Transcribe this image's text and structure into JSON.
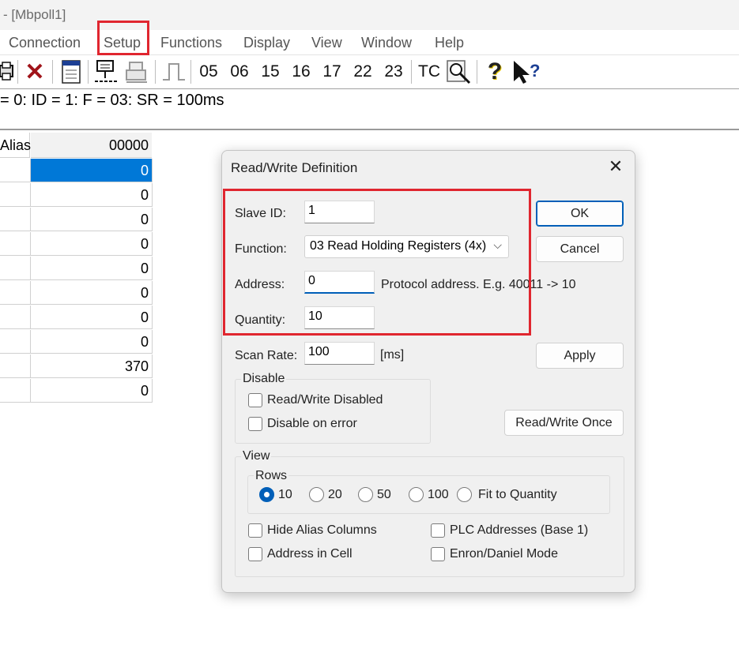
{
  "window": {
    "title": "- [Mbpoll1]"
  },
  "menu": [
    "Connection",
    "Setup",
    "Functions",
    "Display",
    "View",
    "Window",
    "Help"
  ],
  "toolbar": {
    "function_codes": [
      "05",
      "06",
      "15",
      "16",
      "17",
      "22",
      "23"
    ],
    "tc_label": "TC"
  },
  "status_line": "= 0: ID = 1: F = 03: SR = 100ms",
  "grid": {
    "alias_header": "Alias",
    "col_header": "00000",
    "values": [
      "0",
      "0",
      "0",
      "0",
      "0",
      "0",
      "0",
      "0",
      "370",
      "0"
    ]
  },
  "dialog": {
    "title": "Read/Write Definition",
    "slave_id_label": "Slave ID:",
    "slave_id_value": "1",
    "function_label": "Function:",
    "function_value": "03 Read Holding Registers (4x)",
    "address_label": "Address:",
    "address_value": "0",
    "address_hint": "Protocol address. E.g. 40011 -> 10",
    "quantity_label": "Quantity:",
    "quantity_value": "10",
    "scan_rate_label": "Scan Rate:",
    "scan_rate_value": "100",
    "scan_rate_unit": "[ms]",
    "ok_label": "OK",
    "cancel_label": "Cancel",
    "apply_label": "Apply",
    "rw_once_label": "Read/Write Once",
    "disable_group": "Disable",
    "rw_disabled": "Read/Write Disabled",
    "disable_on_error": "Disable on error",
    "view_group": "View",
    "rows_group": "Rows",
    "rows_options": [
      "10",
      "20",
      "50",
      "100",
      "Fit to Quantity"
    ],
    "rows_selected": "10",
    "hide_alias": "Hide Alias Columns",
    "plc_addresses": "PLC Addresses (Base 1)",
    "address_in_cell": "Address in Cell",
    "enron_mode": "Enron/Daniel Mode"
  },
  "colors": {
    "highlight": "#e0262f",
    "accent": "#005fb8",
    "selected_cell": "#0078d7"
  }
}
